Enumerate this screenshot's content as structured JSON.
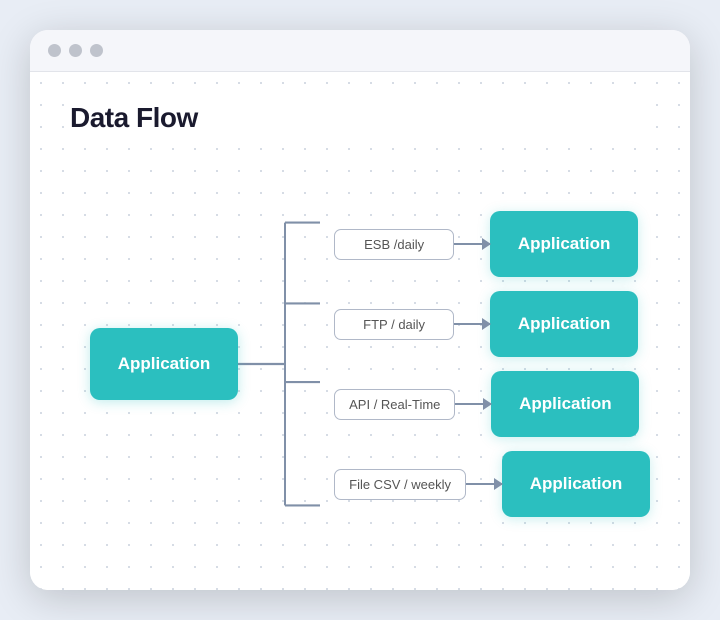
{
  "title": "Data Flow",
  "window": {
    "dots": [
      "dot1",
      "dot2",
      "dot3"
    ]
  },
  "source": {
    "label": "Application"
  },
  "connections": [
    {
      "id": "conn1",
      "label": "ESB /daily",
      "target": "Application"
    },
    {
      "id": "conn2",
      "label": "FTP / daily",
      "target": "Application"
    },
    {
      "id": "conn3",
      "label": "API / Real-Time",
      "target": "Application"
    },
    {
      "id": "conn4",
      "label": "File CSV / weekly",
      "target": "Application"
    }
  ],
  "colors": {
    "teal": "#2bbfbf",
    "pill_border": "#b0b8c8",
    "line": "#8090a8"
  }
}
